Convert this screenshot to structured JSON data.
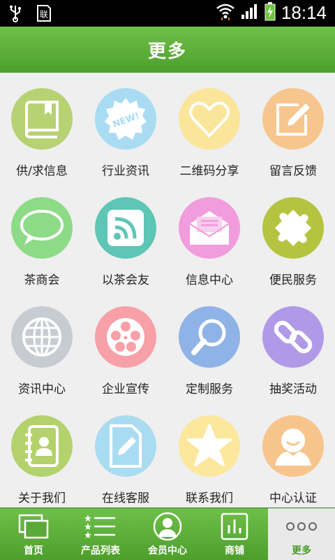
{
  "status_bar": {
    "time": "18:14",
    "icons": [
      "usb-icon",
      "sim-card-icon",
      "wifi-icon",
      "signal-icon",
      "battery-charging-icon"
    ]
  },
  "header": {
    "title": "更多"
  },
  "grid": [
    {
      "label": "供/求信息",
      "icon": "book-icon",
      "color": "#b7d272"
    },
    {
      "label": "行业资讯",
      "icon": "new-badge-icon",
      "color": "#a9dcf3"
    },
    {
      "label": "二维码分享",
      "icon": "heart-icon",
      "color": "#fbe59a"
    },
    {
      "label": "留言反馈",
      "icon": "edit-icon",
      "color": "#f7c68e"
    },
    {
      "label": "茶商会",
      "icon": "chat-bubble-icon",
      "color": "#8ddb86"
    },
    {
      "label": "以茶会友",
      "icon": "rss-icon",
      "color": "#5dc6b5"
    },
    {
      "label": "信息中心",
      "icon": "mail-icon",
      "color": "#f19cdc"
    },
    {
      "label": "便民服务",
      "icon": "puzzle-icon",
      "color": "#b4c440"
    },
    {
      "label": "资讯中心",
      "icon": "globe-icon",
      "color": "#c6ccd2"
    },
    {
      "label": "企业宣传",
      "icon": "film-reel-icon",
      "color": "#f7a0a7"
    },
    {
      "label": "定制服务",
      "icon": "magnifier-icon",
      "color": "#8fb3e6"
    },
    {
      "label": "抽奖活动",
      "icon": "link-icon",
      "color": "#b09ae8"
    },
    {
      "label": "关于我们",
      "icon": "contacts-book-icon",
      "color": "#b3d26c"
    },
    {
      "label": "在线客服",
      "icon": "document-edit-icon",
      "color": "#aadcf1"
    },
    {
      "label": "联系我们",
      "icon": "star-icon",
      "color": "#fce79c"
    },
    {
      "label": "中心认证",
      "icon": "user-icon",
      "color": "#f7c58c"
    }
  ],
  "tabs": [
    {
      "label": "首页",
      "icon": "home-icon"
    },
    {
      "label": "产品列表",
      "icon": "list-icon"
    },
    {
      "label": "会员中心",
      "icon": "member-icon"
    },
    {
      "label": "商铺",
      "icon": "shop-chart-icon"
    },
    {
      "label": "更多",
      "icon": "more-dots-icon"
    }
  ]
}
